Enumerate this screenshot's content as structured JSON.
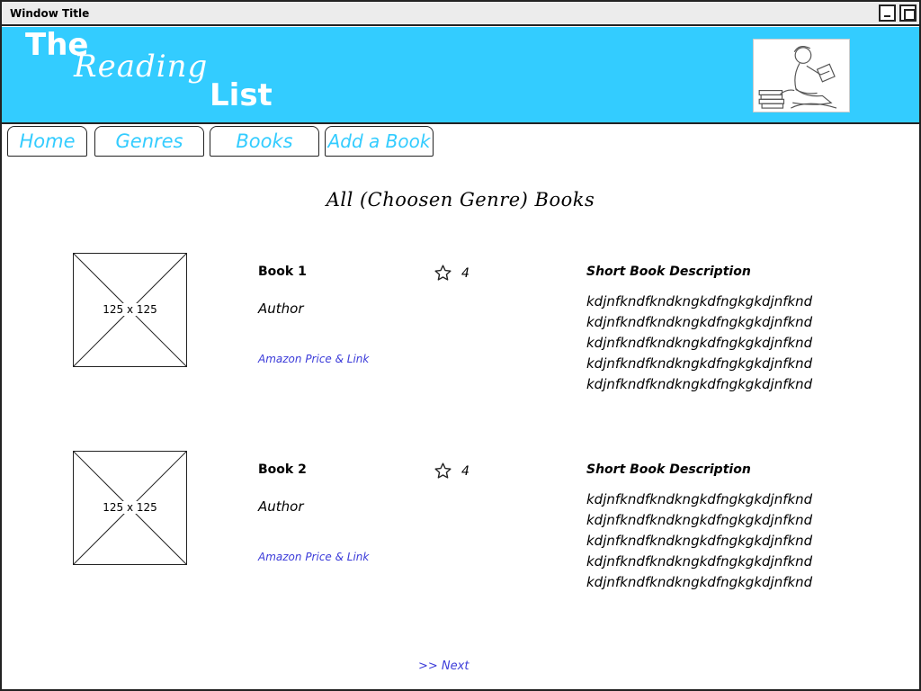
{
  "window": {
    "title": "Window Title"
  },
  "header": {
    "logo_line1": "The",
    "logo_line2": "Reading",
    "logo_line3": "List",
    "background_color": "#33ccff",
    "image_icon": "reading-child-illustration"
  },
  "nav": {
    "tabs": [
      {
        "label": "Home"
      },
      {
        "label": "Genres"
      },
      {
        "label": "Books"
      },
      {
        "label": "Add a Book"
      }
    ],
    "text_color": "#33ccff"
  },
  "main": {
    "page_title": "All (Choosen Genre) Books",
    "books": [
      {
        "thumb_label": "125 x 125",
        "title": "Book 1",
        "author": "Author",
        "link": "Amazon Price & Link",
        "rating": "4",
        "rating_icon": "star-icon",
        "description_title": "Short Book Description",
        "description_lines": [
          "kdjnfkndfkndkngkdfngkgkdjnfknd",
          "kdjnfkndfkndkngkdfngkgkdjnfknd",
          "kdjnfkndfkndkngkdfngkgkdjnfknd",
          "kdjnfkndfkndkngkdfngkgkdjnfknd",
          "kdjnfkndfkndkngkdfngkgkdjnfknd"
        ]
      },
      {
        "thumb_label": "125 x 125",
        "title": "Book 2",
        "author": "Author",
        "link": "Amazon Price & Link",
        "rating": "4",
        "rating_icon": "star-icon",
        "description_title": "Short Book Description",
        "description_lines": [
          "kdjnfkndfkndkngkdfngkgkdjnfknd",
          "kdjnfkndfkndkngkdfngkgkdjnfknd",
          "kdjnfkndfkndkngkdfngkgkdjnfknd",
          "kdjnfkndfkndkngkdfngkgkdjnfknd",
          "kdjnfkndfkndkngkdfngkgkdjnfknd"
        ]
      }
    ],
    "link_color": "#3b3bd9"
  },
  "pagination": {
    "next_label": ">> Next"
  }
}
